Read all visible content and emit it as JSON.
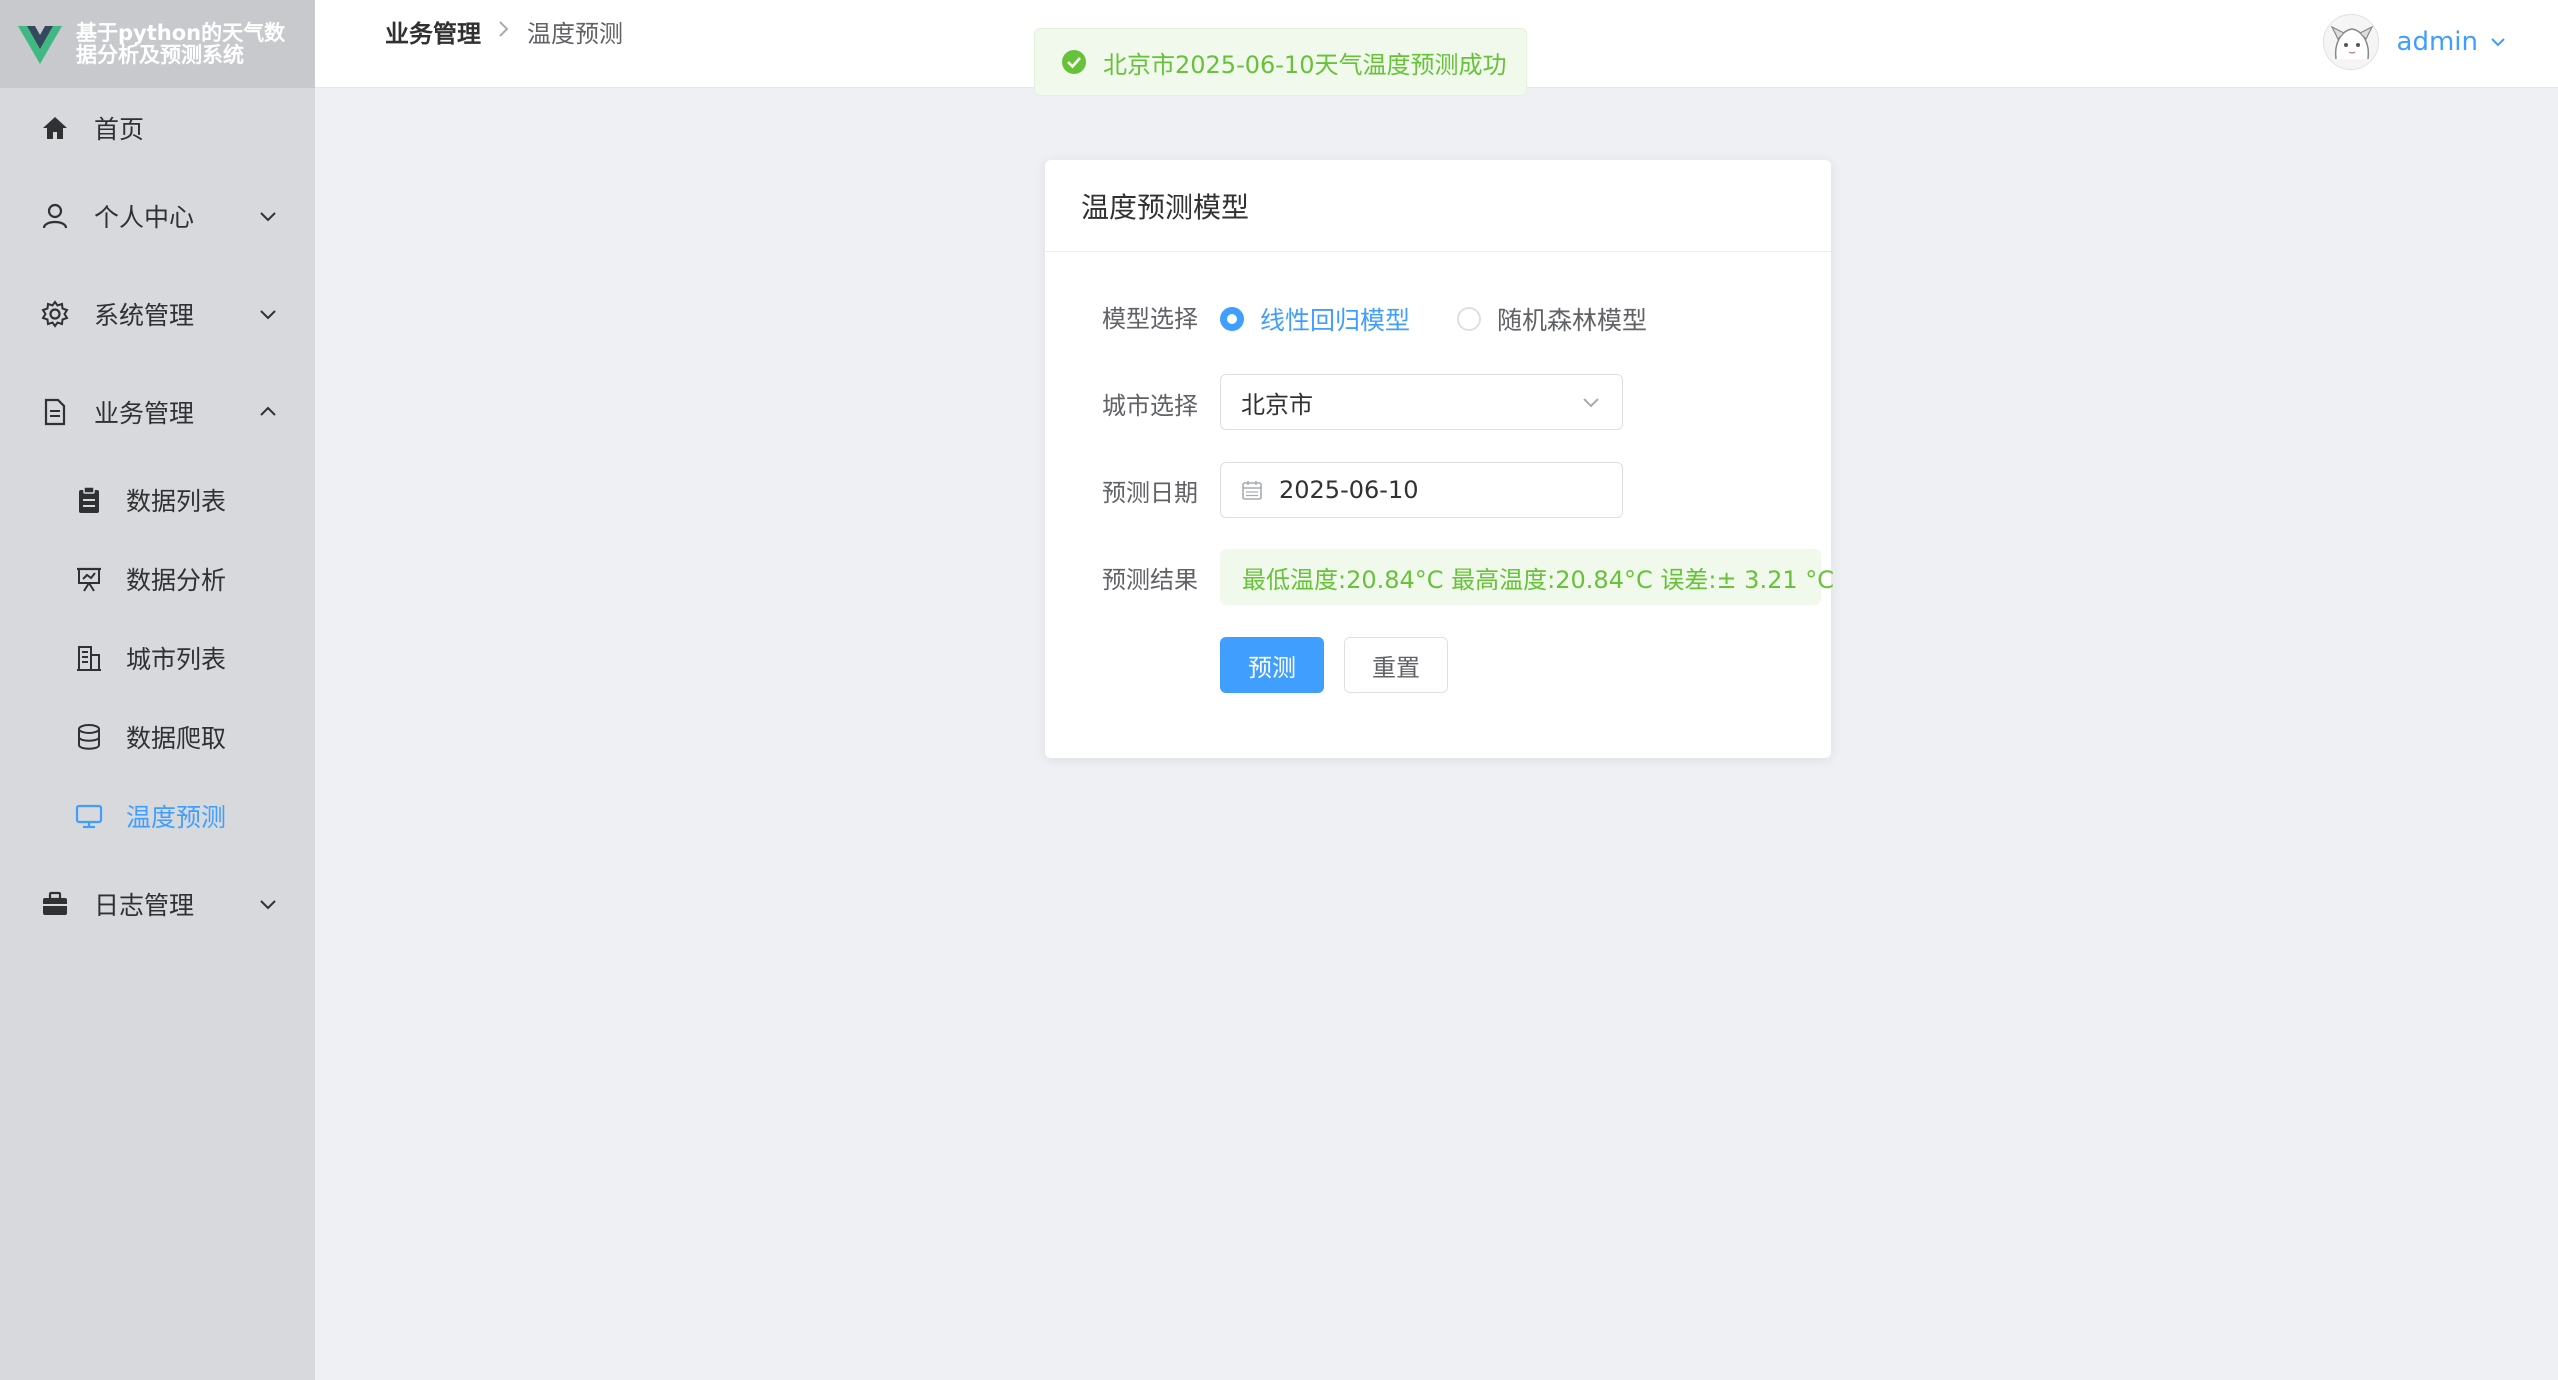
{
  "app": {
    "title_line1": "基于python的天气数",
    "title_line2": "据分析及预测系统"
  },
  "sidebar": {
    "items": [
      {
        "label": "首页",
        "icon": "home-icon"
      },
      {
        "label": "个人中心",
        "icon": "user-icon"
      },
      {
        "label": "系统管理",
        "icon": "gear-icon"
      },
      {
        "label": "业务管理",
        "icon": "document-icon"
      },
      {
        "label": "日志管理",
        "icon": "briefcase-icon"
      }
    ],
    "subitems": [
      {
        "label": "数据列表",
        "icon": "clipboard-icon"
      },
      {
        "label": "数据分析",
        "icon": "presentation-icon"
      },
      {
        "label": "城市列表",
        "icon": "office-building-icon"
      },
      {
        "label": "数据爬取",
        "icon": "database-icon"
      },
      {
        "label": "温度预测",
        "icon": "monitor-icon"
      }
    ],
    "active_color": "#409eff"
  },
  "header": {
    "breadcrumb": [
      "业务管理",
      "温度预测"
    ],
    "username": "admin"
  },
  "toast": {
    "message": "北京市2025-06-10天气温度预测成功",
    "type": "success"
  },
  "card": {
    "title": "温度预测模型",
    "model_label": "模型选择",
    "model_options": [
      "线性回归模型",
      "随机森林模型"
    ],
    "model_selected": "线性回归模型",
    "city_label": "城市选择",
    "city_value": "北京市",
    "date_label": "预测日期",
    "date_value": "2025-06-10",
    "result_label": "预测结果",
    "result_value": "最低温度:20.84°C 最高温度:20.84°C 误差:± 3.21 °C",
    "predict_button": "预测",
    "reset_button": "重置"
  },
  "colors": {
    "primary": "#409eff",
    "success": "#67c23a",
    "success_bg": "#f0f9eb"
  }
}
